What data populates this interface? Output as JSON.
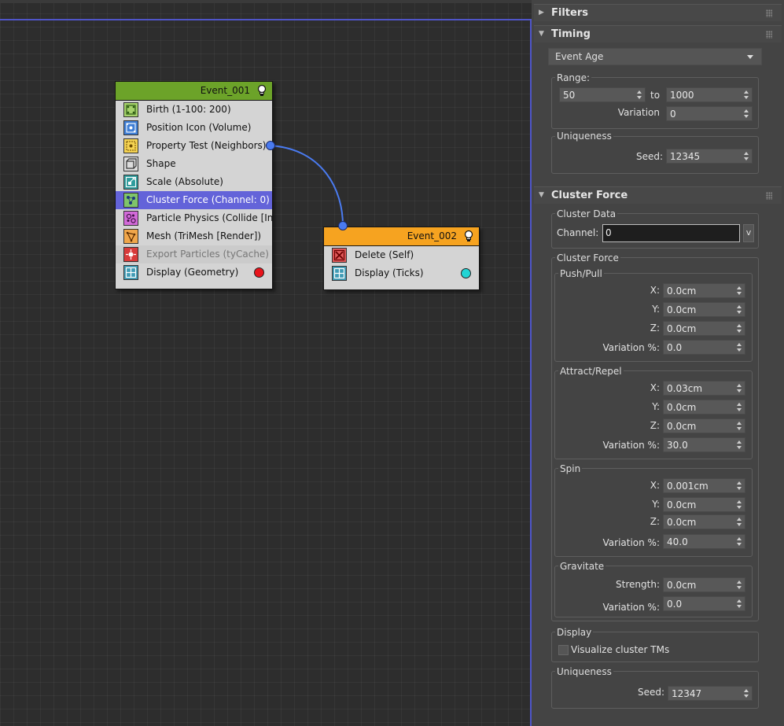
{
  "graph": {
    "event1": {
      "title": "Event_001",
      "header_color": "#6ca329",
      "operators": [
        {
          "label": "Birth (1-100: 200)",
          "icon": "birth-icon"
        },
        {
          "label": "Position Icon (Volume)",
          "icon": "position-icon"
        },
        {
          "label": "Property Test (Neighbors)",
          "icon": "property-test-icon"
        },
        {
          "label": "Shape",
          "icon": "shape-icon"
        },
        {
          "label": "Scale (Absolute)",
          "icon": "scale-icon"
        },
        {
          "label": "Cluster Force (Channel: 0)",
          "icon": "cluster-force-icon",
          "selected": true
        },
        {
          "label": "Particle Physics (Collide [In...",
          "icon": "particle-physics-icon"
        },
        {
          "label": "Mesh (TriMesh [Render])",
          "icon": "mesh-icon"
        },
        {
          "label": "Export Particles (tyCache)",
          "icon": "export-particles-icon",
          "disabled": true
        },
        {
          "label": "Display (Geometry)",
          "icon": "display-icon",
          "dot_color": "#e8141b"
        }
      ]
    },
    "event2": {
      "title": "Event_002",
      "header_color": "#f6a320",
      "operators": [
        {
          "label": "Delete (Self)",
          "icon": "delete-icon"
        },
        {
          "label": "Display (Ticks)",
          "icon": "display-icon",
          "dot_color": "#22d4d4"
        }
      ]
    },
    "wire_color": "#4a7bf0"
  },
  "panel": {
    "filters": {
      "title": "Filters"
    },
    "timing": {
      "title": "Timing",
      "mode": "Event Age",
      "range_label": "Range:",
      "range_from": "50",
      "range_to_label": "to",
      "range_to": "1000",
      "variation_label": "Variation",
      "variation": "0",
      "uniqueness_label": "Uniqueness",
      "seed_label": "Seed:",
      "seed": "12345"
    },
    "cluster_force": {
      "title": "Cluster Force",
      "cluster_data_label": "Cluster Data",
      "channel_label": "Channel:",
      "channel": "0",
      "channel_btn": "v",
      "cluster_force_label": "Cluster Force",
      "push_pull": {
        "label": "Push/Pull",
        "x": "0.0cm",
        "y": "0.0cm",
        "z": "0.0cm",
        "variation": "0.0"
      },
      "attract_repel": {
        "label": "Attract/Repel",
        "x": "0.03cm",
        "y": "0.0cm",
        "z": "0.0cm",
        "variation": "30.0"
      },
      "spin": {
        "label": "Spin",
        "x": "0.001cm",
        "y": "0.0cm",
        "z": "0.0cm",
        "variation": "40.0"
      },
      "gravitate": {
        "label": "Gravitate",
        "strength_label": "Strength:",
        "strength": "0.0cm",
        "variation": "0.0"
      },
      "x_label": "X:",
      "y_label": "Y:",
      "z_label": "Z:",
      "variation_label": "Variation %:",
      "display_label": "Display",
      "visualize_label": "Visualize cluster TMs",
      "visualize_checked": false,
      "uniqueness_label": "Uniqueness",
      "seed_label": "Seed:",
      "seed": "12347"
    }
  }
}
